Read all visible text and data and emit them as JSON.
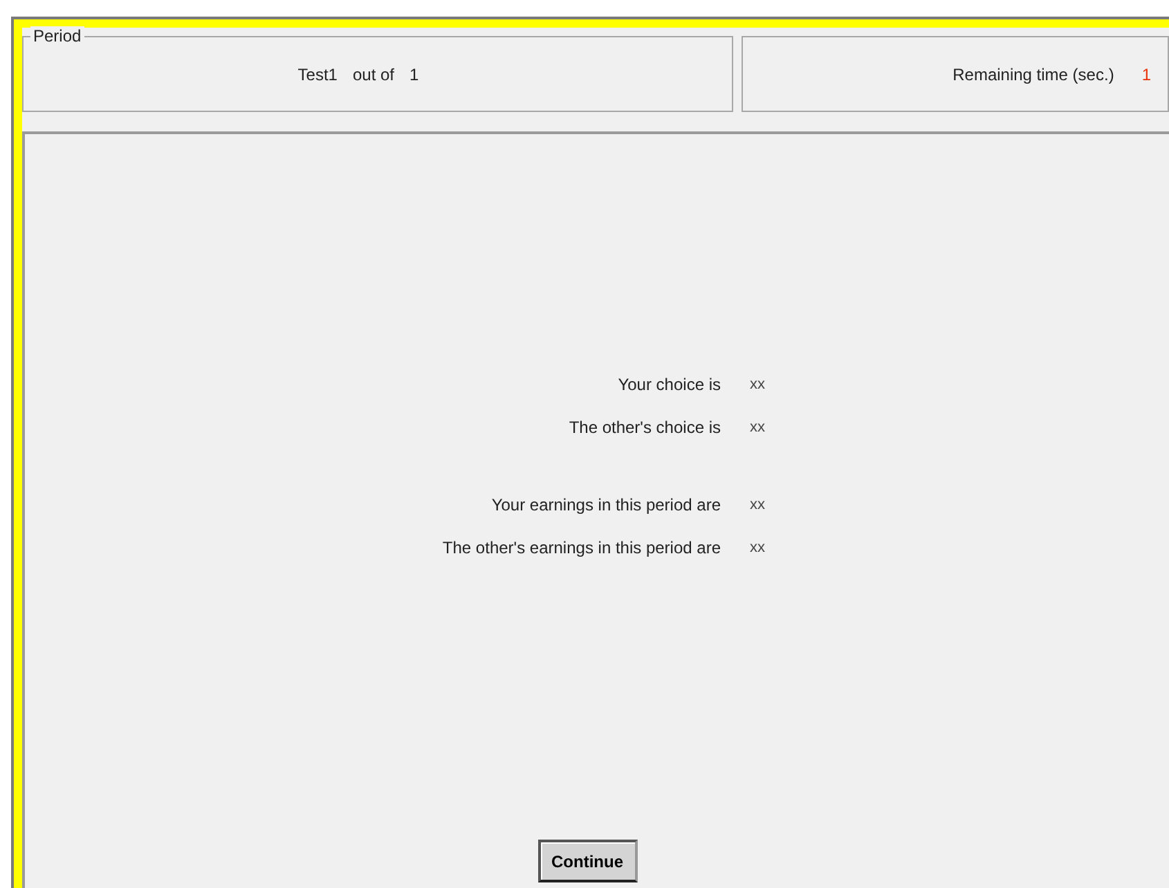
{
  "period": {
    "legend": "Period",
    "name": "Test1",
    "out_of": "out of",
    "total": "1"
  },
  "timer": {
    "label": "Remaining time (sec.)",
    "value": "1"
  },
  "results": [
    [
      {
        "label": "Your choice is",
        "value": "xx"
      },
      {
        "label": "The other's choice is",
        "value": "xx"
      }
    ],
    [
      {
        "label": "Your earnings in this period are",
        "value": "xx"
      },
      {
        "label": "The other's earnings in this period are",
        "value": "xx"
      }
    ]
  ],
  "continue_button": "Continue"
}
